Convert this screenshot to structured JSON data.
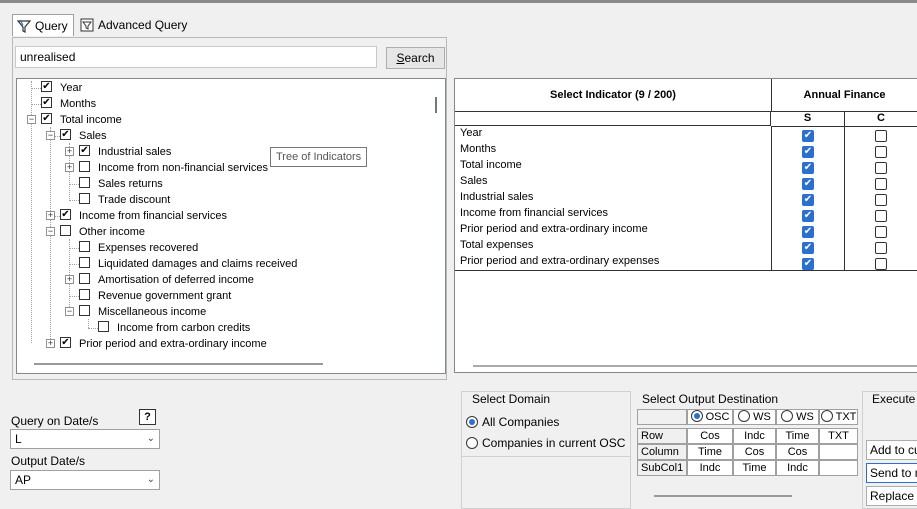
{
  "tabs": [
    {
      "label": "Query"
    },
    {
      "label": "Advanced Query"
    }
  ],
  "search": {
    "value": "unrealised",
    "button_label": "Search",
    "button_mnemonic": "S",
    "button_rest": "earch"
  },
  "tree": {
    "tooltip": "Tree of Indicators",
    "items": [
      {
        "label": "Year",
        "checked": true
      },
      {
        "label": "Months",
        "checked": true
      },
      {
        "label": "Total income",
        "checked": true
      },
      {
        "label": "Sales",
        "checked": true
      },
      {
        "label": "Industrial sales",
        "checked": true
      },
      {
        "label": "Income from non-financial services",
        "checked": false
      },
      {
        "label": "Sales returns",
        "checked": false
      },
      {
        "label": "Trade discount",
        "checked": false
      },
      {
        "label": "Income from financial services",
        "checked": true
      },
      {
        "label": "Other income",
        "checked": false
      },
      {
        "label": "Expenses recovered",
        "checked": false
      },
      {
        "label": "Liquidated damages and claims received",
        "checked": false
      },
      {
        "label": "Amortisation of deferred income",
        "checked": false
      },
      {
        "label": "Revenue government grant",
        "checked": false
      },
      {
        "label": "Miscellaneous income",
        "checked": false
      },
      {
        "label": "Income from carbon credits",
        "checked": false
      },
      {
        "label": "Prior period and extra-ordinary income",
        "checked": true
      }
    ]
  },
  "indicator_grid": {
    "header": "Select Indicator (9 / 200)",
    "group_header": "Annual Finance",
    "col_s": "S",
    "col_c": "C",
    "rows": [
      {
        "label": "Year",
        "s": true,
        "c": false
      },
      {
        "label": "Months",
        "s": true,
        "c": false
      },
      {
        "label": "Total income",
        "s": true,
        "c": false
      },
      {
        "label": "Sales",
        "s": true,
        "c": false
      },
      {
        "label": "Industrial sales",
        "s": true,
        "c": false
      },
      {
        "label": "Income from financial services",
        "s": true,
        "c": false
      },
      {
        "label": "Prior period and extra-ordinary income",
        "s": true,
        "c": false
      },
      {
        "label": "Total expenses",
        "s": true,
        "c": false
      },
      {
        "label": "Prior period and extra-ordinary expenses",
        "s": true,
        "c": false
      }
    ]
  },
  "query_dates": {
    "label": "Query on Date/s",
    "value": "L",
    "output_label": "Output Date/s",
    "output_value": "AP"
  },
  "domain": {
    "title": "Select Domain",
    "options": [
      {
        "label": "All Companies",
        "selected": true
      },
      {
        "label": "Companies in current OSC",
        "selected": false
      }
    ]
  },
  "output_dest": {
    "title": "Select Output Destination",
    "columns": [
      {
        "label": "OSC",
        "selected": true
      },
      {
        "label": "WS",
        "selected": false
      },
      {
        "label": "WS",
        "selected": false
      },
      {
        "label": "TXT",
        "selected": false
      }
    ],
    "rows": [
      {
        "label": "Row",
        "cells": [
          "Cos",
          "Indc",
          "Time",
          "TXT"
        ]
      },
      {
        "label": "Column",
        "cells": [
          "Time",
          "Cos",
          "Cos",
          ""
        ]
      },
      {
        "label": "SubCol1",
        "cells": [
          "Indc",
          "Time",
          "Indc",
          ""
        ]
      }
    ]
  },
  "execute": {
    "title": "Execute",
    "buttons": [
      "Add to cu",
      "Send to n",
      "Replace c"
    ]
  }
}
